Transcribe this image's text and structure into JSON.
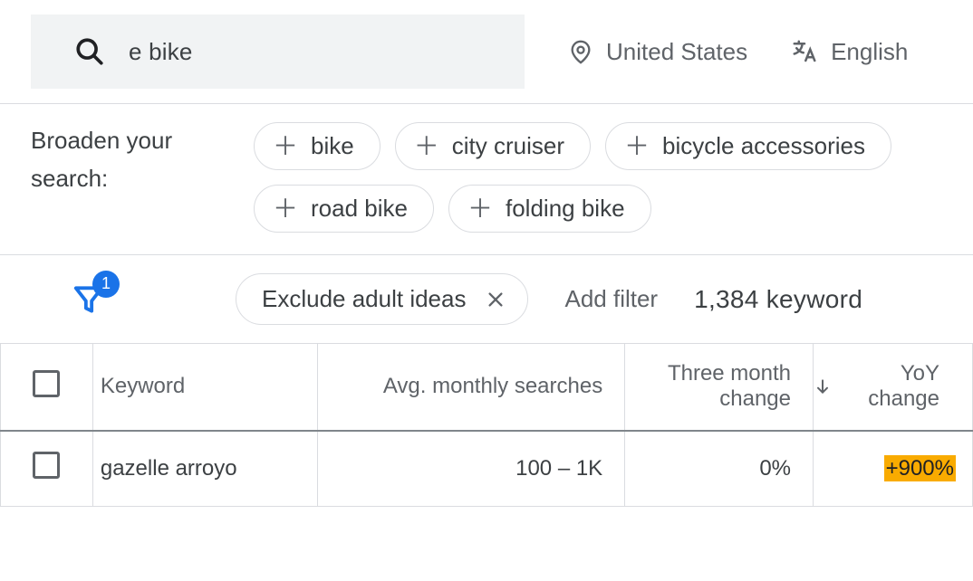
{
  "search": {
    "value": "e bike"
  },
  "location": {
    "label": "United States"
  },
  "language": {
    "label": "English"
  },
  "broaden": {
    "label": "Broaden your search:",
    "chips": [
      "bike",
      "city cruiser",
      "bicycle accessories",
      "road bike",
      "folding bike"
    ]
  },
  "filters": {
    "badge": "1",
    "active": {
      "label": "Exclude adult ideas"
    },
    "add_label": "Add filter",
    "count_text": "1,384 keyword"
  },
  "table": {
    "headers": {
      "keyword": "Keyword",
      "avg": "Avg. monthly searches",
      "three_month": "Three month change",
      "yoy": "YoY change"
    },
    "rows": [
      {
        "keyword": "gazelle arroyo",
        "avg": "100 – 1K",
        "three_month": "0%",
        "yoy": "+900%"
      }
    ]
  }
}
